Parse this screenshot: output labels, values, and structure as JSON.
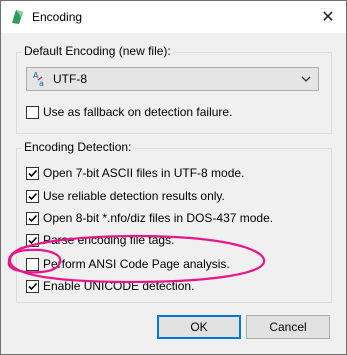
{
  "window": {
    "title": "Encoding",
    "close_glyph": "✕",
    "app_icon": "notepad-leaf-icon"
  },
  "default_encoding": {
    "group_label": "Default Encoding (new file):",
    "selected": "UTF-8",
    "option_icon": "encoding-letters-icon",
    "fallback_label": "Use as fallback on detection failure.",
    "fallback_checked": false
  },
  "encoding_detection": {
    "group_label": "Encoding Detection:",
    "options": [
      {
        "label": "Open 7-bit ASCII files in UTF-8 mode.",
        "checked": true
      },
      {
        "label": "Use reliable detection results only.",
        "checked": true
      },
      {
        "label": "Open 8-bit *.nfo/diz files in DOS-437 mode.",
        "checked": true
      },
      {
        "label": "Parse encoding file tags.",
        "checked": true
      },
      {
        "label": "Perform ANSI Code Page analysis.",
        "checked": false
      },
      {
        "label": "Enable UNICODE detection.",
        "checked": true
      }
    ]
  },
  "buttons": {
    "ok": "OK",
    "cancel": "Cancel"
  },
  "colors": {
    "annotation": "#e8158c",
    "default_button_border": "#0078d7"
  }
}
